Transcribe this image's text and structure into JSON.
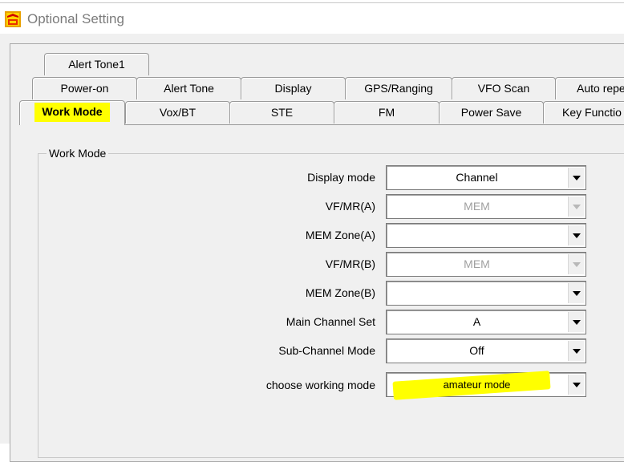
{
  "window": {
    "title": "Optional Setting"
  },
  "tabs": {
    "row1": [
      "Alert Tone1"
    ],
    "row2": [
      "Power-on",
      "Alert Tone",
      "Display",
      "GPS/Ranging",
      "VFO Scan",
      "Auto repe"
    ],
    "row3": [
      "Work Mode",
      "Vox/BT",
      "STE",
      "FM",
      "Power Save",
      "Key Functio"
    ]
  },
  "work_mode": {
    "group_title": "Work Mode",
    "fields": [
      {
        "label": "Display mode",
        "value": "Channel",
        "enabled": true
      },
      {
        "label": "VF/MR(A)",
        "value": "MEM",
        "enabled": false
      },
      {
        "label": "MEM Zone(A)",
        "value": "",
        "enabled": true
      },
      {
        "label": "VF/MR(B)",
        "value": "MEM",
        "enabled": false
      },
      {
        "label": "MEM Zone(B)",
        "value": "",
        "enabled": true
      },
      {
        "label": "Main Channel Set",
        "value": "A",
        "enabled": true
      },
      {
        "label": "Sub-Channel Mode",
        "value": "Off",
        "enabled": true
      },
      {
        "label": "choose working mode",
        "value": "amateur mode",
        "enabled": true
      }
    ]
  },
  "colors": {
    "highlight": "#ffff00",
    "disabled_text": "#a0a0a0"
  }
}
